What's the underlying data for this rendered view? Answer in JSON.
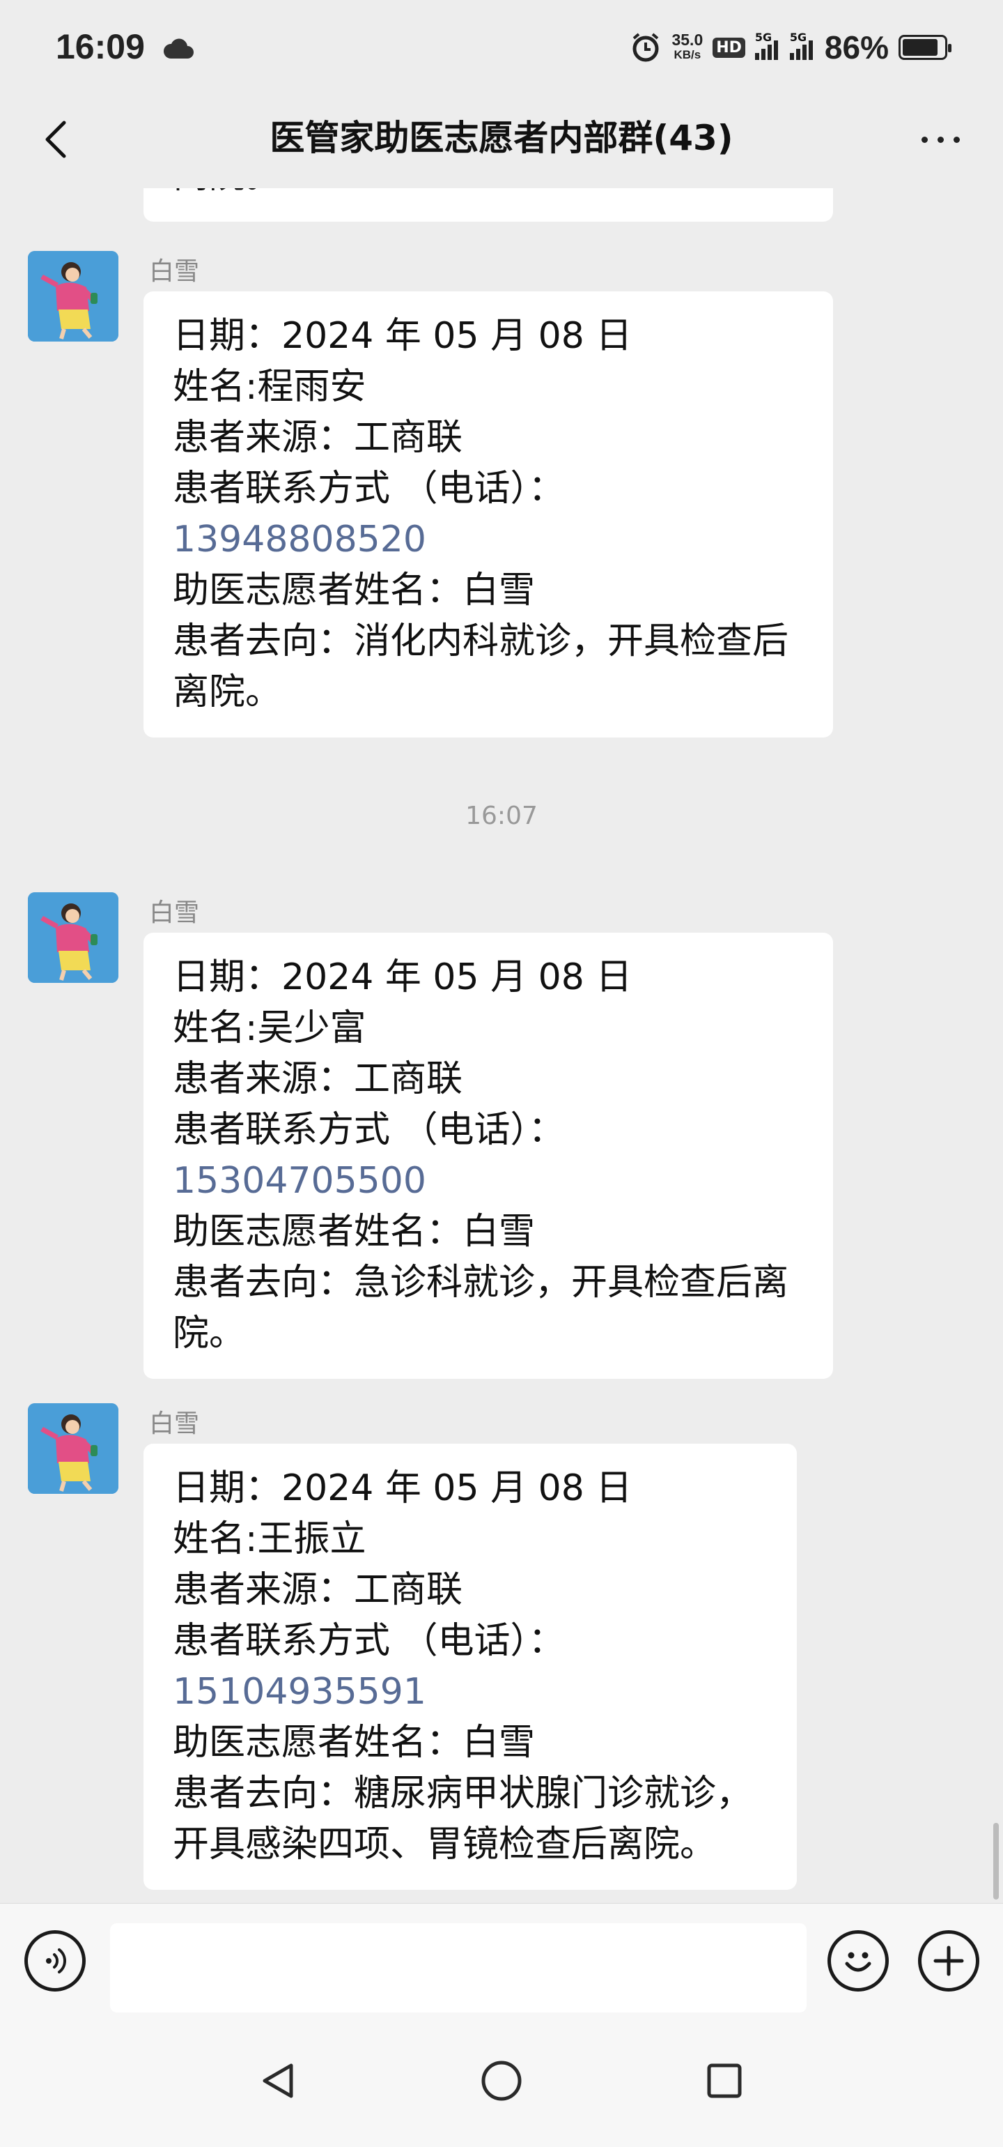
{
  "status_bar": {
    "time": "16:09",
    "net_speed_value": "35.0",
    "net_speed_unit": "KB/s",
    "hd_label": "HD",
    "sim1_label": "5G",
    "sim2_label": "5G",
    "battery_percent": "86%",
    "battery_level": 0.86
  },
  "header": {
    "title": "医管家助医志愿者内部群(43)"
  },
  "chat": {
    "partial_top_text": "离院。",
    "timestamp": "16:07",
    "messages": [
      {
        "sender": "白雪",
        "lines": {
          "date": "日期：2024 年 05 月 08 日",
          "name": "姓名:程雨安",
          "source": "患者来源：工商联",
          "contact": "患者联系方式 （电话）：",
          "phone": "13948808520",
          "volunteer": "助医志愿者姓名：白雪",
          "direction": "患者去向：消化内科就诊，开具检查后离院。"
        }
      },
      {
        "sender": "白雪",
        "lines": {
          "date": "日期：2024 年 05 月 08 日",
          "name": "姓名:吴少富",
          "source": "患者来源：工商联",
          "contact": "患者联系方式 （电话）：",
          "phone": "15304705500",
          "volunteer": "助医志愿者姓名：白雪",
          "direction": "患者去向：急诊科就诊，开具检查后离院。"
        }
      },
      {
        "sender": "白雪",
        "lines": {
          "date": "日期：2024 年 05 月 08 日",
          "name": "姓名:王振立",
          "source": "患者来源：工商联",
          "contact": "患者联系方式 （电话）：",
          "phone": "15104935591",
          "volunteer": "助医志愿者姓名：白雪",
          "direction": "患者去向：糖尿病甲状腺门诊就诊，开具感染四项、胃镜检查后离院。"
        }
      }
    ]
  },
  "input_bar": {
    "placeholder": ""
  },
  "colors": {
    "background": "#ededed",
    "bubble": "#ffffff",
    "link": "#576b95"
  }
}
